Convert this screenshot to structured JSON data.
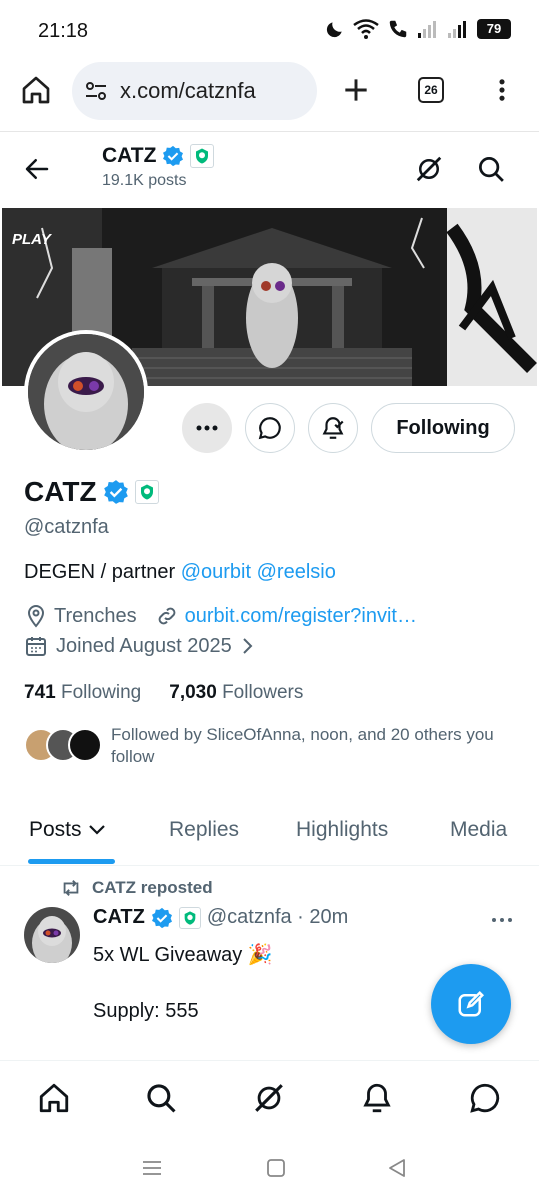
{
  "status": {
    "time": "21:18",
    "battery": "79"
  },
  "browser": {
    "url": "x.com/catznfa",
    "tab_count": "26"
  },
  "header": {
    "name": "CATZ",
    "posts": "19.1K posts"
  },
  "banner": {
    "play_label": "PLAY"
  },
  "profile": {
    "name": "CATZ",
    "handle": "@catznfa",
    "bio_prefix": "DEGEN / partner ",
    "bio_mention1": "@ourbit",
    "bio_mention2": "@reelsio",
    "location": "Trenches",
    "website": "ourbit.com/register?invit…",
    "joined": "Joined August 2025",
    "following_count": "741",
    "following_label": "Following",
    "followers_count": "7,030",
    "followers_label": "Followers",
    "followed_by": "Followed by SliceOfAnna, noon, and 20 others you follow",
    "follow_button": "Following"
  },
  "tabs": [
    "Posts",
    "Replies",
    "Highlights",
    "Media"
  ],
  "post": {
    "repost_label": "CATZ reposted",
    "author": "CATZ",
    "handle_time": "@catznfa · 20m",
    "line1": "5x WL Giveaway 🎉",
    "line2": "Supply: 555"
  },
  "colors": {
    "accent": "#1d9bf0",
    "text": "#0f1419",
    "muted": "#536471"
  }
}
